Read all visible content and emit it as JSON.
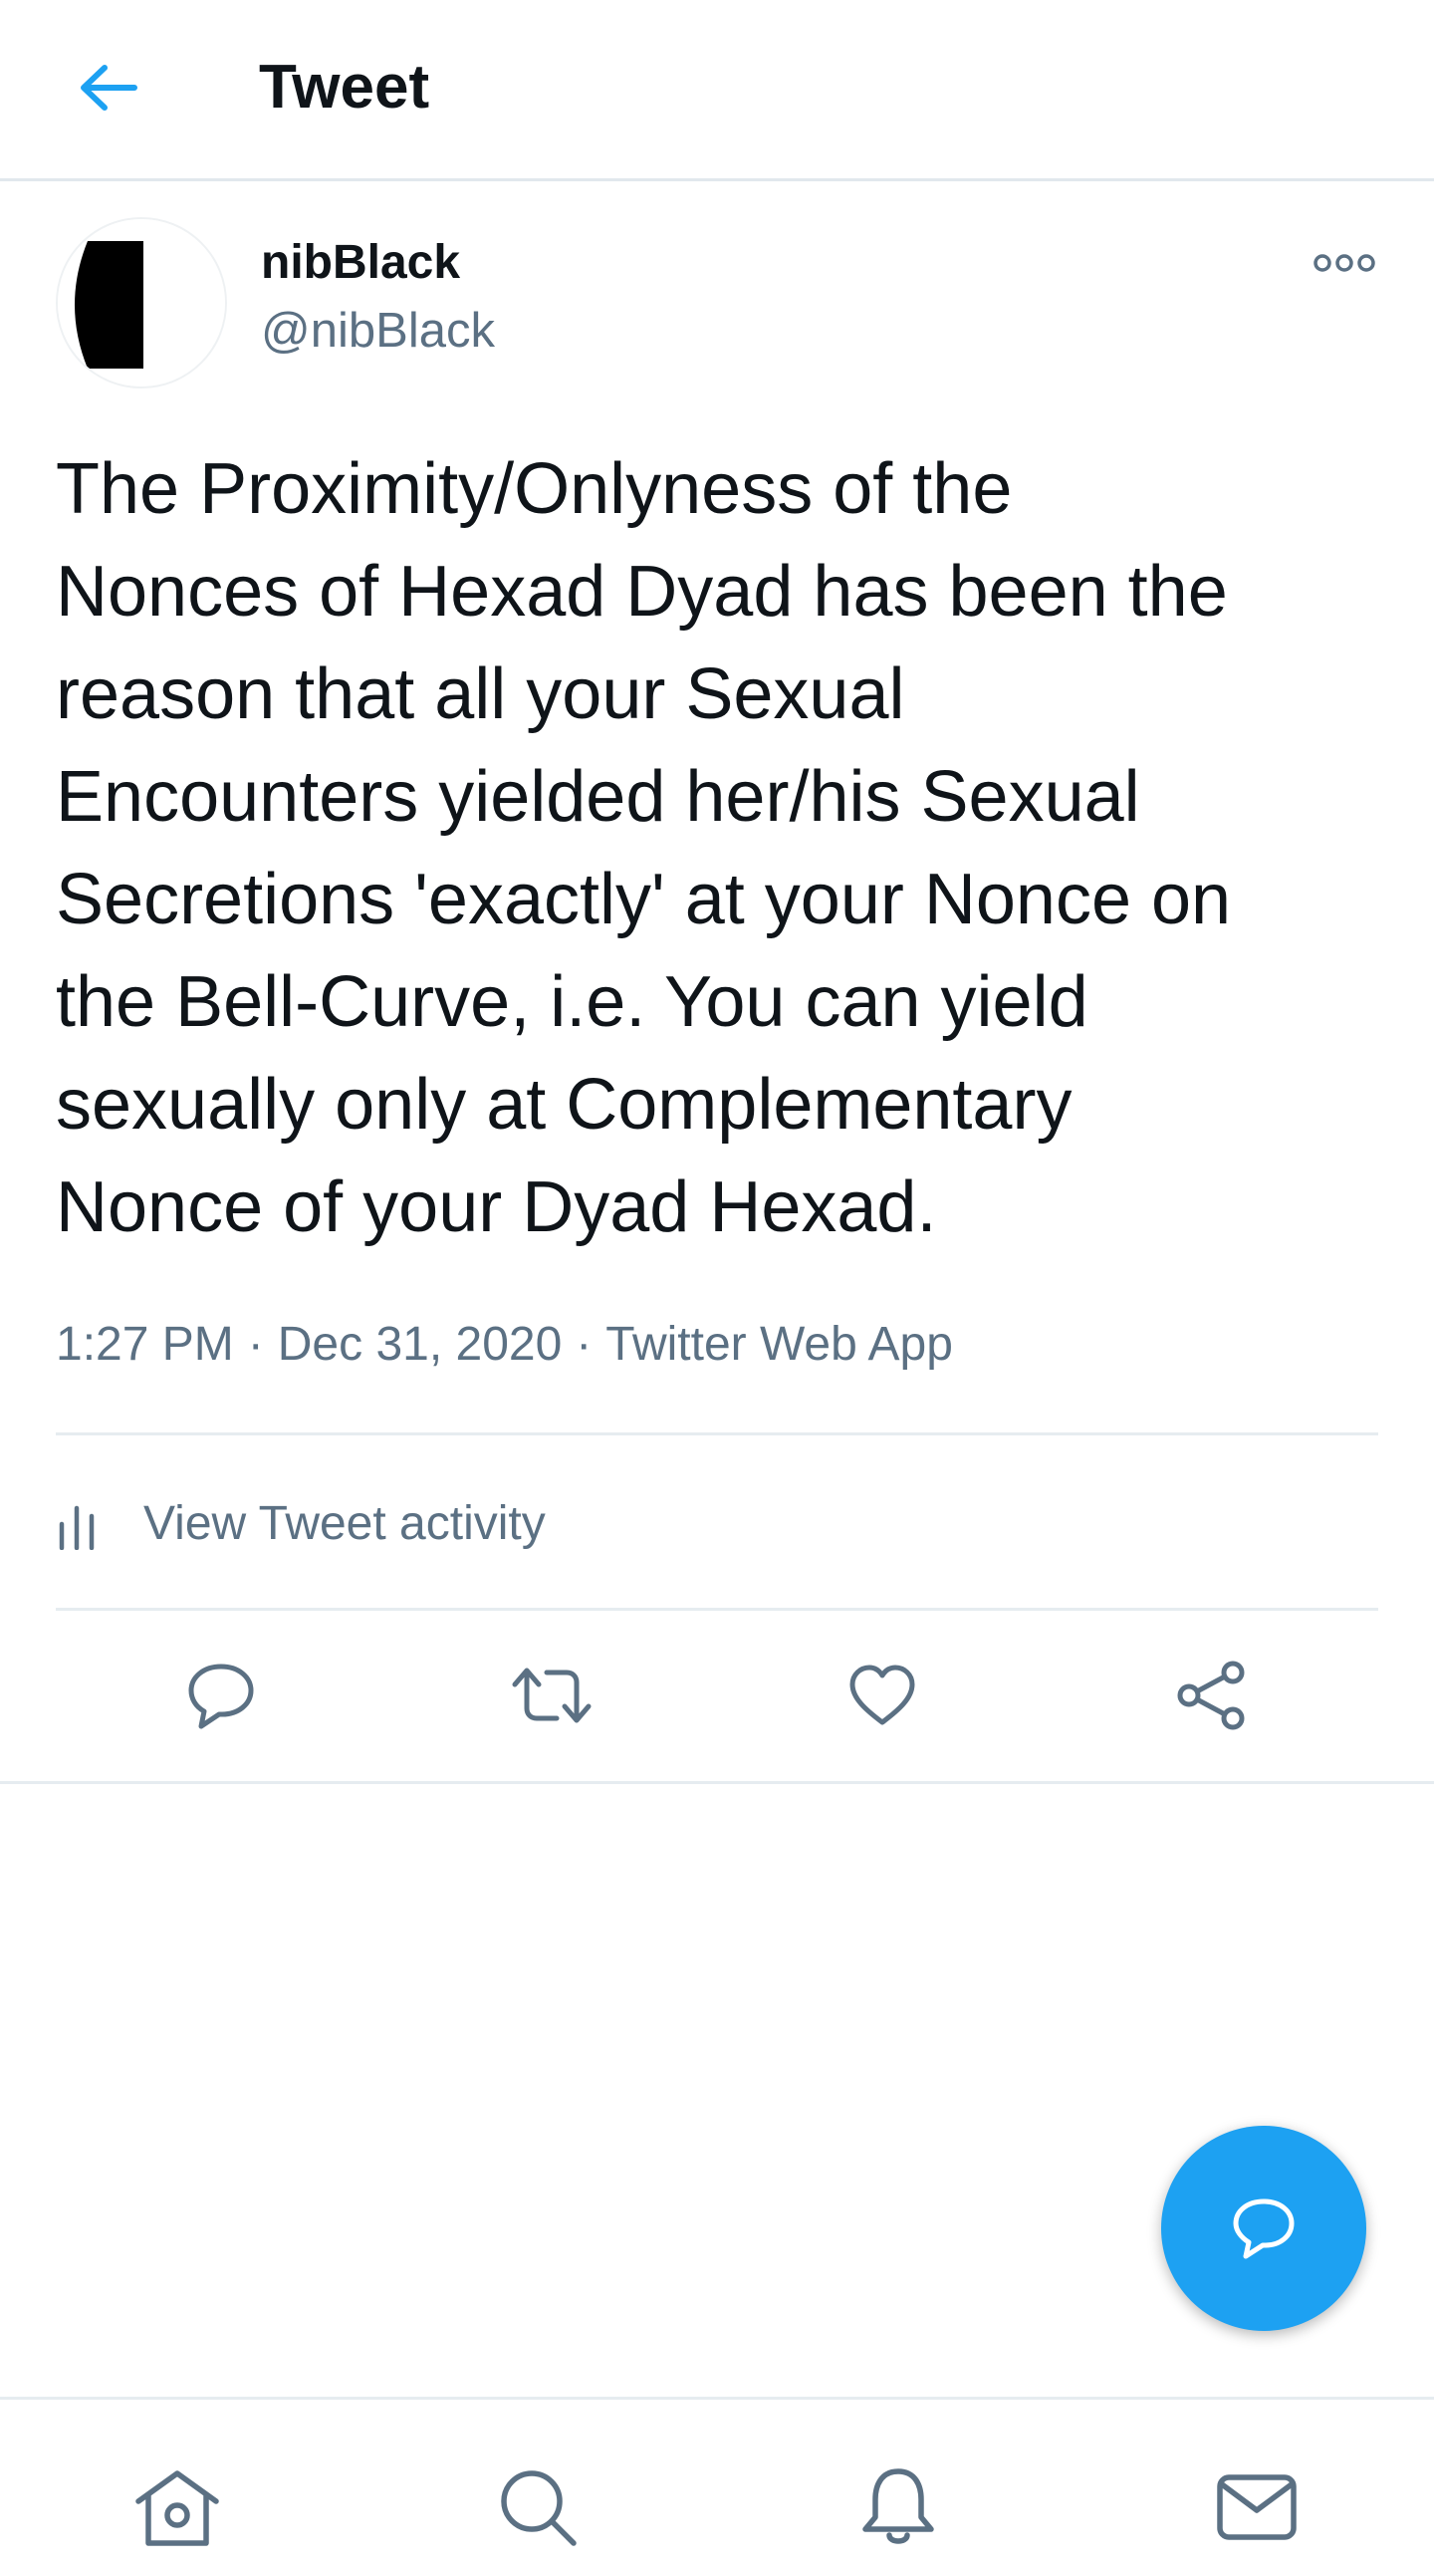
{
  "header": {
    "title": "Tweet",
    "back_icon": "arrow-left-icon"
  },
  "author": {
    "name": "nibBlack",
    "handle": "@nibBlack"
  },
  "tweet": {
    "text": "The Proximity/Onlyness of the\nNonces of Hexad Dyad has been the\nreason that all your Sexual\nEncounters yielded her/his Sexual\nSecretions 'exactly' at your Nonce on\nthe Bell-Curve, i.e. You can yield\nsexually only at Complementary\nNonce of your Dyad Hexad.",
    "time": "1:27 PM",
    "date": "Dec 31, 2020",
    "source": "Twitter Web App",
    "separator": "·"
  },
  "activity": {
    "label": "View Tweet activity"
  },
  "colors": {
    "accent": "#1da1f2",
    "text_primary": "#0f1419",
    "text_secondary": "#5b7083",
    "divider": "#e6ecf0"
  },
  "actions": [
    "reply-icon",
    "retweet-icon",
    "like-icon",
    "share-icon"
  ],
  "bottom_nav": [
    "home-icon",
    "search-icon",
    "notifications-icon",
    "messages-icon"
  ],
  "fab_icon": "compose-reply-icon"
}
